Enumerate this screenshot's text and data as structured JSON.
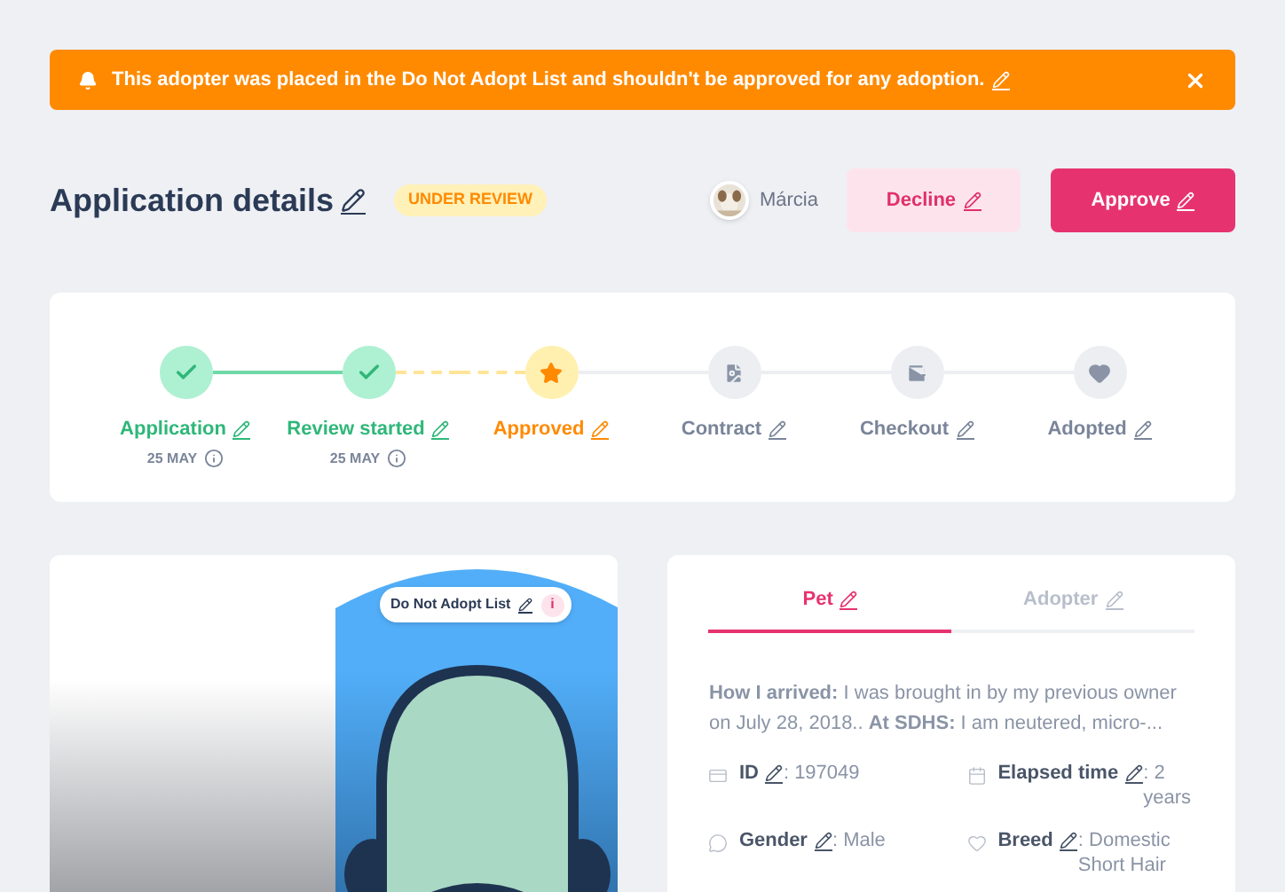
{
  "alert": {
    "message": "This adopter was placed in the Do Not Adopt List and shouldn't be approved for any adoption."
  },
  "header": {
    "title": "Application details",
    "status": "UNDER REVIEW",
    "user": "Márcia",
    "buttons": [
      {
        "label": "Decline",
        "kind": "secondary"
      },
      {
        "label": "Approve",
        "kind": "primary"
      }
    ]
  },
  "steps": [
    {
      "label": "Application",
      "completed": true,
      "active": false,
      "date": "25 MAY"
    },
    {
      "label": "Review started",
      "completed": true,
      "active": false,
      "date": "25 MAY"
    },
    {
      "label": "Approved",
      "completed": false,
      "active": true
    },
    {
      "label": "Contract",
      "completed": false,
      "active": false
    },
    {
      "label": "Checkout",
      "completed": false,
      "active": false
    },
    {
      "label": "Adopted",
      "completed": false,
      "active": false
    }
  ],
  "profile": {
    "tag": "Do Not Adopt List",
    "tag_badge": "i"
  },
  "details": {
    "tabs": [
      {
        "label": "Pet",
        "selected": true
      },
      {
        "label": "Adopter",
        "selected": false
      }
    ],
    "description": "**How I arrived:** I was brought in by my previous owner on July 28, 2018..  **At SDHS:** I am neutered, micro-...",
    "fields": [
      {
        "label": "ID",
        "value": ": 197049"
      },
      {
        "label": "Elapsed time",
        "value": ": 2 years"
      },
      {
        "label": "Gender",
        "value": ": Male"
      },
      {
        "label": "Breed",
        "value": ": Domestic Short Hair"
      }
    ]
  }
}
